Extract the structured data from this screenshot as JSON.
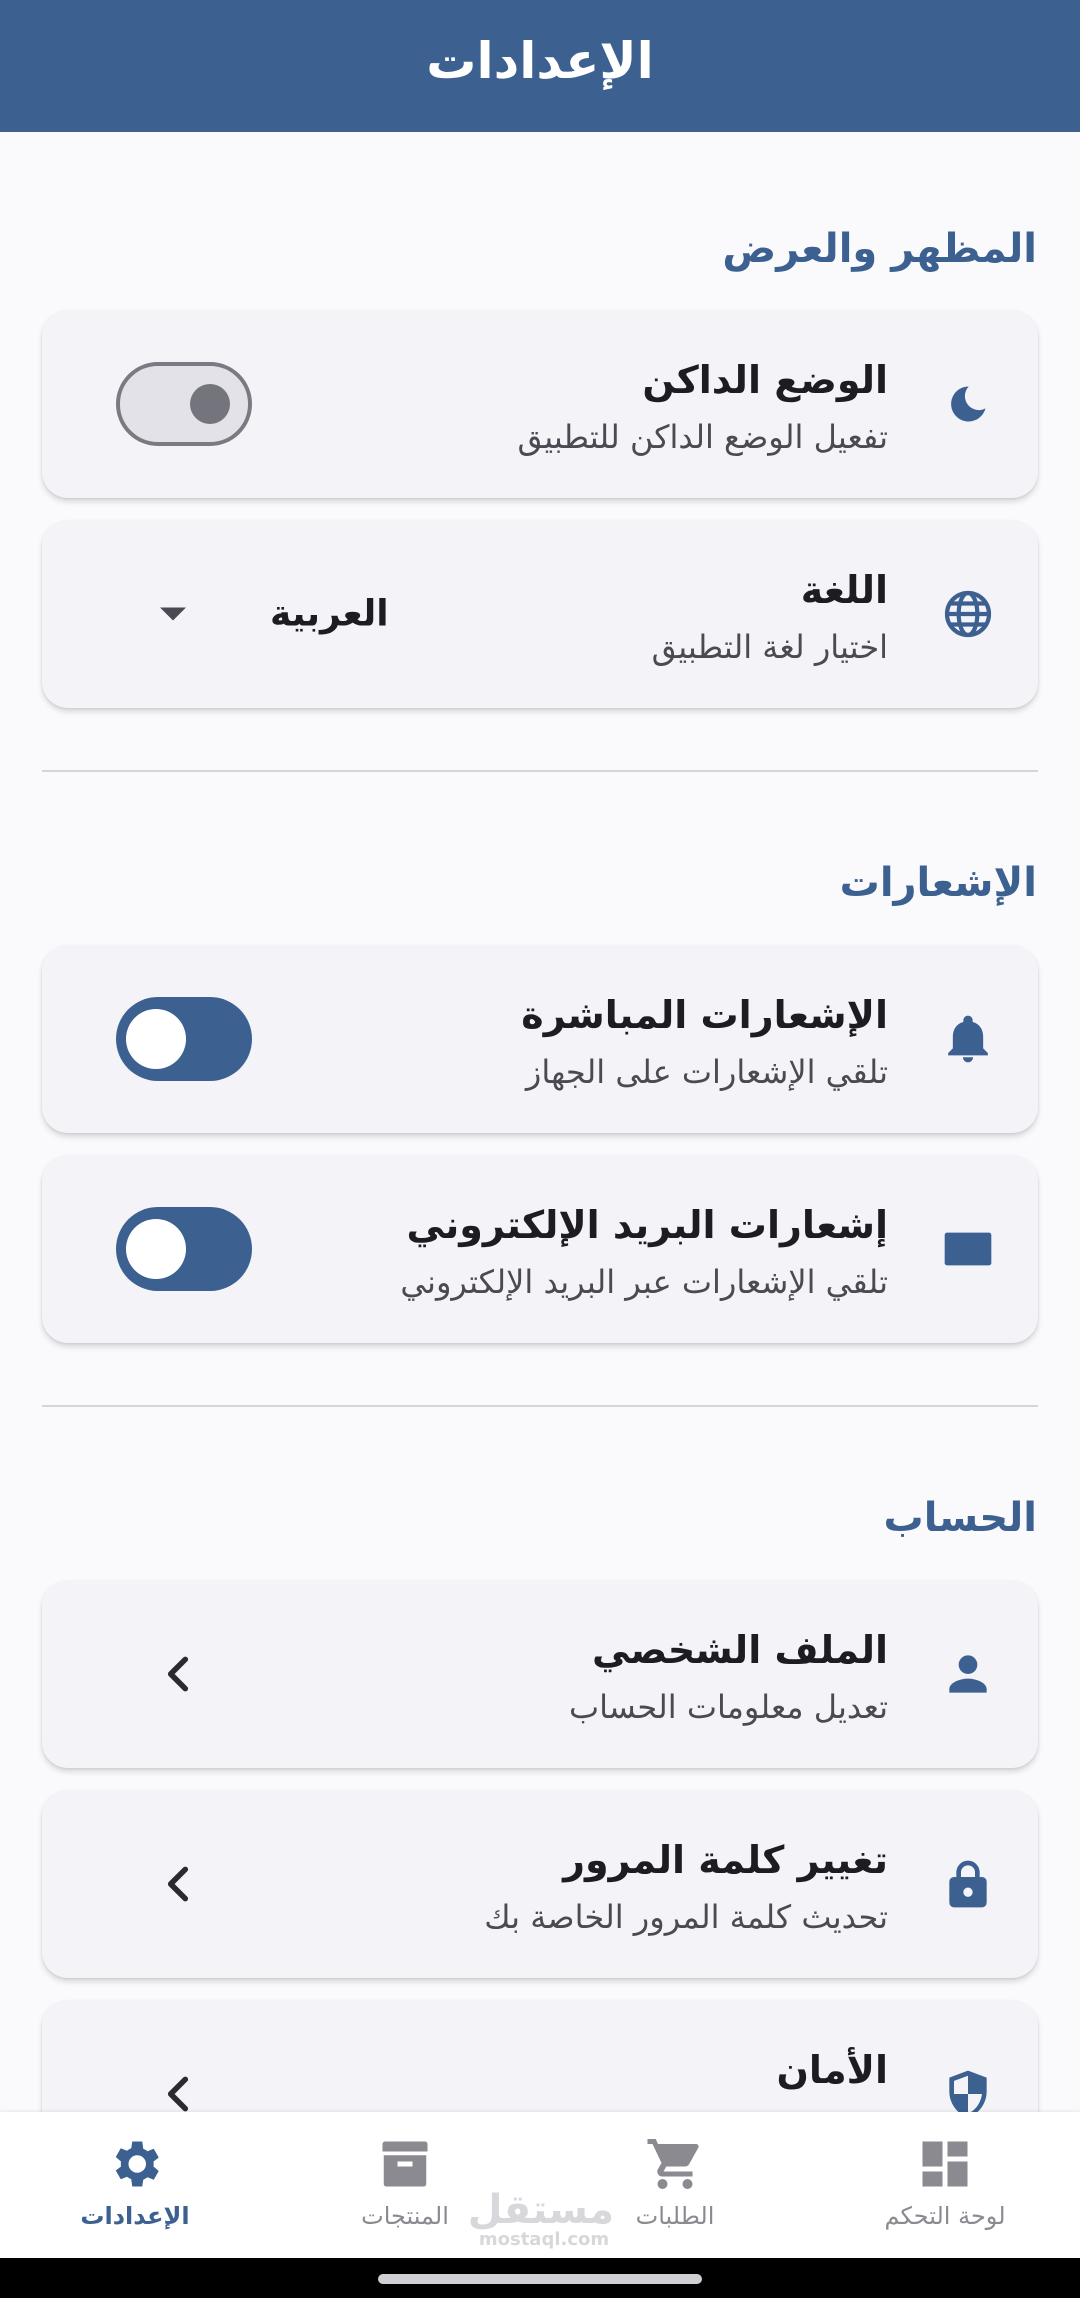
{
  "appbar": {
    "title": "الإعدادات"
  },
  "sections": {
    "appearance": {
      "title": "المظهر والعرض"
    },
    "notifications": {
      "title": "الإشعارات"
    },
    "account": {
      "title": "الحساب"
    }
  },
  "settings": {
    "dark_mode": {
      "title": "الوضع الداكن",
      "subtitle": "تفعيل الوضع الداكن للتطبيق",
      "enabled": false,
      "icon": "moon-icon"
    },
    "language": {
      "title": "اللغة",
      "subtitle": "اختيار لغة التطبيق",
      "selected": "العربية",
      "icon": "globe-icon"
    },
    "push_notifications": {
      "title": "الإشعارات المباشرة",
      "subtitle": "تلقي الإشعارات على الجهاز",
      "enabled": true,
      "icon": "bell-icon"
    },
    "email_notifications": {
      "title": "إشعارات البريد الإلكتروني",
      "subtitle": "تلقي الإشعارات عبر البريد الإلكتروني",
      "enabled": true,
      "icon": "mail-icon"
    },
    "profile": {
      "title": "الملف الشخصي",
      "subtitle": "تعديل معلومات الحساب",
      "icon": "person-icon"
    },
    "change_password": {
      "title": "تغيير كلمة المرور",
      "subtitle": "تحديث كلمة المرور الخاصة بك",
      "icon": "lock-icon"
    },
    "security": {
      "title": "الأمان",
      "icon": "shield-icon"
    }
  },
  "bottom_nav": {
    "settings": {
      "label": "الإعدادات",
      "active": true,
      "icon": "gear-icon"
    },
    "products": {
      "label": "المنتجات",
      "active": false,
      "icon": "archive-icon"
    },
    "orders": {
      "label": "الطلبات",
      "active": false,
      "icon": "cart-icon"
    },
    "dashboard": {
      "label": "لوحة التحكم",
      "active": false,
      "icon": "dashboard-icon"
    }
  },
  "watermark": {
    "brand": "مستقل",
    "domain": "mostaql.com"
  },
  "colors": {
    "primary": "#3c6090",
    "background": "#fafafd",
    "card": "#f3f3f8",
    "inactive": "#8a8a90"
  }
}
